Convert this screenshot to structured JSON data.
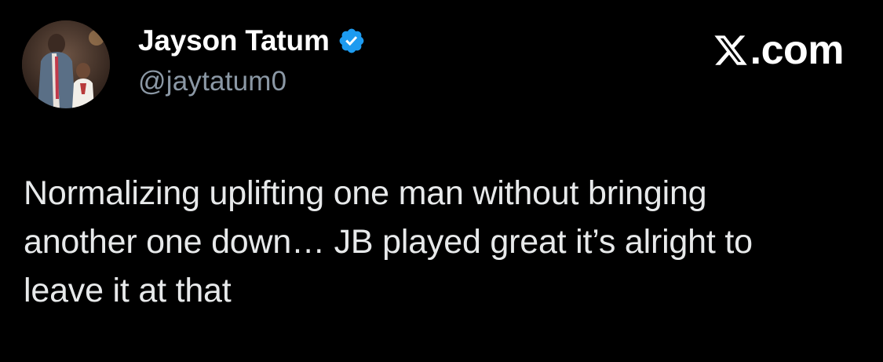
{
  "author": {
    "name": "Jayson Tatum",
    "handle": "@jaytatum0",
    "verified_icon": "verified-badge-icon",
    "avatar_icon": "profile-photo"
  },
  "branding": {
    "logo_icon": "x-logo-icon",
    "domain_suffix": ".com"
  },
  "tweet": {
    "lines": [
      "Normalizing uplifting one man without bringing",
      "another one down… JB played great it’s alright to",
      "leave it at that"
    ]
  },
  "colors": {
    "background": "#000000",
    "name": "#ffffff",
    "handle": "#8b98a5",
    "body_text": "#e7e9ea",
    "verified": "#1d9bf0"
  }
}
